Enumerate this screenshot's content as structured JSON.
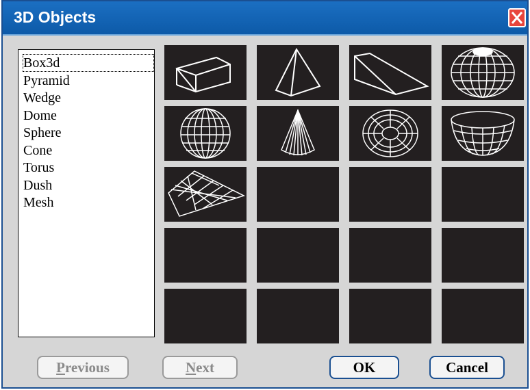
{
  "dialog": {
    "title": "3D Objects"
  },
  "list": {
    "items": [
      "Box3d",
      "Pyramid",
      "Wedge",
      "Dome",
      "Sphere",
      "Cone",
      "Torus",
      "Dush",
      "Mesh"
    ],
    "selected": "Box3d"
  },
  "grid": {
    "tiles": [
      "box-icon",
      "pyramid-icon",
      "wedge-icon",
      "dome-icon",
      "sphere-icon",
      "cone-icon",
      "torus-icon",
      "dish-icon",
      "mesh-icon"
    ]
  },
  "buttons": {
    "previous": {
      "prefix": "P",
      "rest": "revious"
    },
    "next": {
      "prefix": "N",
      "rest": "ext"
    },
    "ok": "OK",
    "cancel": "Cancel"
  },
  "colors": {
    "title_bar": "#0d5aa8",
    "tile_bg": "#231f20",
    "close": "#e8453c"
  }
}
